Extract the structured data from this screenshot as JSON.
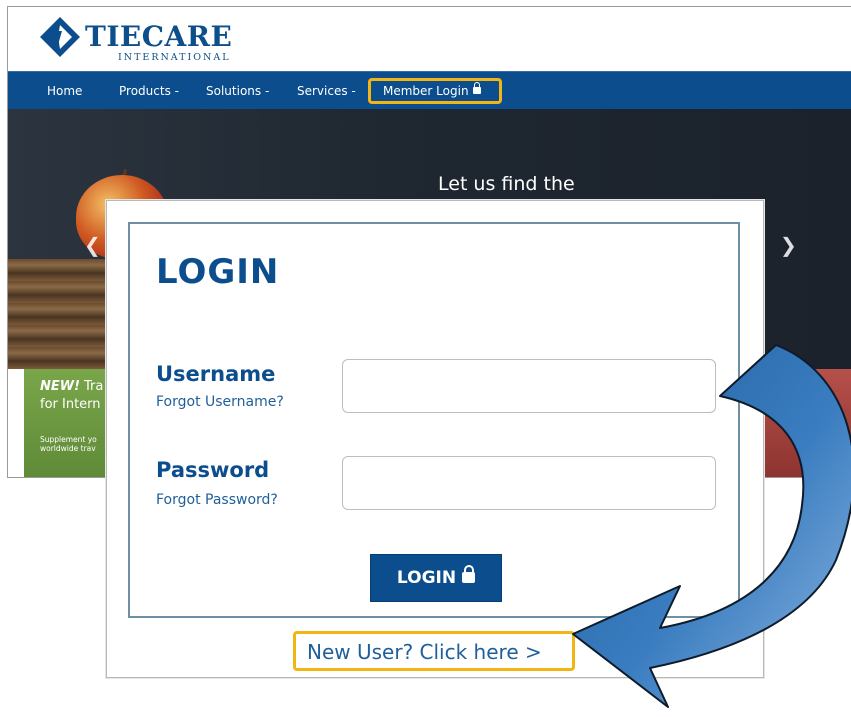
{
  "brand": {
    "name": "TIECARE",
    "subtitle": "INTERNATIONAL",
    "accent": "#0c4e8d"
  },
  "nav": {
    "items": [
      "Home",
      "Products -",
      "Solutions -",
      "Services -"
    ],
    "member_login": "Member Login"
  },
  "hero": {
    "headline": "Let us find the"
  },
  "promo": {
    "new_label": "NEW!",
    "line1_rest": "Tra",
    "line2": "for Intern",
    "small_line1": "Supplement yo",
    "small_line2": "worldwide trav"
  },
  "login": {
    "title": "LOGIN",
    "username_label": "Username",
    "forgot_username": "Forgot Username?",
    "password_label": "Password",
    "forgot_password": "Forgot Password?",
    "button_label": "LOGIN",
    "new_user_link": "New User? Click here >"
  },
  "colors": {
    "highlight": "#f2b514",
    "nav_bg": "#0c4e8d",
    "arrow": "#2f6fae"
  },
  "icons": {
    "nav_lock": "lock-icon",
    "button_lock": "lock-icon",
    "logo": "logo-mark-icon",
    "carousel_prev": "chevron-left-icon",
    "carousel_next": "chevron-right-icon",
    "curved_arrow": "curved-arrow-icon"
  }
}
